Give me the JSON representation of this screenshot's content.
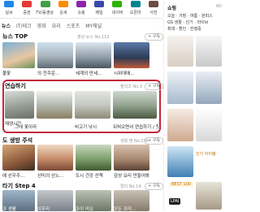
{
  "top_icons": [
    {
      "label": "날씨",
      "icon": "weather-icon",
      "color": "#1e88e5"
    },
    {
      "label": "증권",
      "icon": "stock-icon",
      "color": "#e53935"
    },
    {
      "label": "TV/동영상",
      "icon": "tv-icon",
      "color": "#43a047"
    },
    {
      "label": "운세",
      "icon": "fortune-icon",
      "color": "#fb8c00"
    },
    {
      "label": "쇼핑",
      "icon": "shopping-icon",
      "color": "#8e24aa"
    },
    {
      "label": "메일",
      "icon": "mail-icon",
      "color": "#3949ab"
    },
    {
      "label": "네이버",
      "icon": "naver-icon",
      "color": "#2db400"
    },
    {
      "label": "오픈마",
      "icon": "open-icon",
      "color": "#00838f"
    },
    {
      "label": "사전",
      "icon": "dict-icon",
      "color": "#6d4c41"
    }
  ],
  "tabs": [
    "뉴스",
    "IT/테크",
    "영화",
    "요리",
    "스포츠",
    "MY채널"
  ],
  "section1": {
    "title": "뉴스 TOP",
    "meta": "영상 뉴스 No.112",
    "subscribe": "+ 구독"
  },
  "section1_captions": [
    "불꽃",
    "의 전주운...",
    "세계의 만세...",
    "시위대에..."
  ],
  "section2": {
    "title": "연습하기",
    "meta": "필리즈 No.3",
    "subscribe": "+ 구독"
  },
  "section2_captions": [
    "재생시간",
    "그네 꽃이라기",
    "비고기 낚시",
    "뒤혀오면서 연습하기 / 첫..."
  ],
  "section3": {
    "title": "도 생방 주석",
    "meta": "생활 명 No.296",
    "subscribe": "+ 구독"
  },
  "section3_captions": [
    "에 선우주...",
    "선미의 선노...",
    "도시 건강 산책",
    "감성 요리 만들어봐..."
  ],
  "section4": {
    "title": "타기 Step 4",
    "meta": "멀티 No.14",
    "subscribe": "+ 구독"
  },
  "section4_captions": [
    "과 생활",
    "이우리",
    "조이 미오",
    "모든 조미..."
  ],
  "right": {
    "title": "쇼핑",
    "ad": "AD",
    "lines": [
      "오늘 · 가장 · 여름 · 원피스",
      "GS 생활 · 인기 · 라이브",
      "최대 · 할인 · 진행중"
    ],
    "best_label": "BEST 100",
    "price_label": "인기 아이템",
    "banner": "LPAI"
  }
}
